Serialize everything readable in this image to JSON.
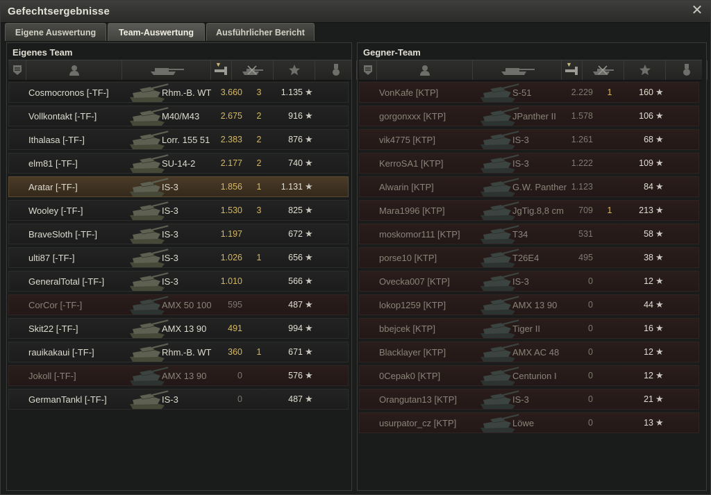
{
  "window": {
    "title": "Gefechtsergebnisse"
  },
  "tabs": [
    {
      "label": "Eigene Auswertung",
      "active": false
    },
    {
      "label": "Team-Auswertung",
      "active": true
    },
    {
      "label": "Ausführlicher Bericht",
      "active": false
    }
  ],
  "icons": {
    "close": "close-icon",
    "star": "★",
    "columns": [
      "rank-icon",
      "player-icon",
      "tank-icon",
      "damage-icon",
      "kills-icon",
      "xp-star-icon",
      "medal-icon"
    ]
  },
  "colors": {
    "gold": "#d7b862",
    "dead_row": "#2a1d1b",
    "self_row": "#4a3b27"
  },
  "own_team": {
    "title": "Eigenes Team",
    "players": [
      {
        "name": "Cosmocronos [-TF-]",
        "tank": "Rhm.-B. WT",
        "damage": "3.660",
        "kills": "3",
        "xp": "1.135",
        "status": "alive"
      },
      {
        "name": "Vollkontakt [-TF-]",
        "tank": "M40/M43",
        "damage": "2.675",
        "kills": "2",
        "xp": "916",
        "status": "alive"
      },
      {
        "name": "Ithalasa [-TF-]",
        "tank": "Lorr. 155 51",
        "damage": "2.383",
        "kills": "2",
        "xp": "876",
        "status": "alive"
      },
      {
        "name": "elm81 [-TF-]",
        "tank": "SU-14-2",
        "damage": "2.177",
        "kills": "2",
        "xp": "740",
        "status": "alive"
      },
      {
        "name": "Aratar [-TF-]",
        "tank": "IS-3",
        "damage": "1.856",
        "kills": "1",
        "xp": "1.131",
        "status": "self"
      },
      {
        "name": "Wooley [-TF-]",
        "tank": "IS-3",
        "damage": "1.530",
        "kills": "3",
        "xp": "825",
        "status": "alive"
      },
      {
        "name": "BraveSloth [-TF-]",
        "tank": "IS-3",
        "damage": "1.197",
        "kills": "",
        "xp": "672",
        "status": "alive"
      },
      {
        "name": "ulti87 [-TF-]",
        "tank": "IS-3",
        "damage": "1.026",
        "kills": "1",
        "xp": "656",
        "status": "alive"
      },
      {
        "name": "GeneralTotal [-TF-]",
        "tank": "IS-3",
        "damage": "1.010",
        "kills": "",
        "xp": "566",
        "status": "alive"
      },
      {
        "name": "CorCor [-TF-]",
        "tank": "AMX 50 100",
        "damage": "595",
        "kills": "",
        "xp": "487",
        "status": "dead"
      },
      {
        "name": "Skit22 [-TF-]",
        "tank": "AMX 13 90",
        "damage": "491",
        "kills": "",
        "xp": "994",
        "status": "alive"
      },
      {
        "name": "rauikakaui [-TF-]",
        "tank": "Rhm.-B. WT",
        "damage": "360",
        "kills": "1",
        "xp": "671",
        "status": "alive"
      },
      {
        "name": "Jokoll [-TF-]",
        "tank": "AMX 13 90",
        "damage": "0",
        "kills": "",
        "xp": "576",
        "status": "dead"
      },
      {
        "name": "GermanTankl [-TF-]",
        "tank": "IS-3",
        "damage": "0",
        "kills": "",
        "xp": "487",
        "status": "alive"
      }
    ]
  },
  "enemy_team": {
    "title": "Gegner-Team",
    "players": [
      {
        "name": "VonKafe [KTP]",
        "tank": "S-51",
        "damage": "2.229",
        "kills": "1",
        "xp": "160",
        "status": "dead"
      },
      {
        "name": "gorgonxxx [KTP]",
        "tank": "JPanther II",
        "damage": "1.578",
        "kills": "",
        "xp": "106",
        "status": "dead"
      },
      {
        "name": "vik4775 [KTP]",
        "tank": "IS-3",
        "damage": "1.261",
        "kills": "",
        "xp": "68",
        "status": "dead"
      },
      {
        "name": "KerroSA1 [KTP]",
        "tank": "IS-3",
        "damage": "1.222",
        "kills": "",
        "xp": "109",
        "status": "dead"
      },
      {
        "name": "Alwarin [KTP]",
        "tank": "G.W. Panther",
        "damage": "1.123",
        "kills": "",
        "xp": "84",
        "status": "dead"
      },
      {
        "name": "Mara1996 [KTP]",
        "tank": "JgTig.8,8 cm",
        "damage": "709",
        "kills": "1",
        "xp": "213",
        "status": "dead"
      },
      {
        "name": "moskomor111 [KTP]",
        "tank": "T34",
        "damage": "531",
        "kills": "",
        "xp": "58",
        "status": "dead"
      },
      {
        "name": "porse10 [KTP]",
        "tank": "T26E4",
        "damage": "495",
        "kills": "",
        "xp": "38",
        "status": "dead"
      },
      {
        "name": "Ovecka007 [KTP]",
        "tank": "IS-3",
        "damage": "0",
        "kills": "",
        "xp": "12",
        "status": "dead"
      },
      {
        "name": "lokop1259 [KTP]",
        "tank": "AMX 13 90",
        "damage": "0",
        "kills": "",
        "xp": "44",
        "status": "dead"
      },
      {
        "name": "bbejcek [KTP]",
        "tank": "Tiger II",
        "damage": "0",
        "kills": "",
        "xp": "16",
        "status": "dead"
      },
      {
        "name": "Blacklayer [KTP]",
        "tank": "AMX AC 48",
        "damage": "0",
        "kills": "",
        "xp": "12",
        "status": "dead"
      },
      {
        "name": "0Cepak0 [KTP]",
        "tank": "Centurion I",
        "damage": "0",
        "kills": "",
        "xp": "12",
        "status": "dead"
      },
      {
        "name": "Orangutan13 [KTP]",
        "tank": "IS-3",
        "damage": "0",
        "kills": "",
        "xp": "21",
        "status": "dead"
      },
      {
        "name": "usurpator_cz [KTP]",
        "tank": "Löwe",
        "damage": "0",
        "kills": "",
        "xp": "13",
        "status": "dead"
      }
    ]
  }
}
